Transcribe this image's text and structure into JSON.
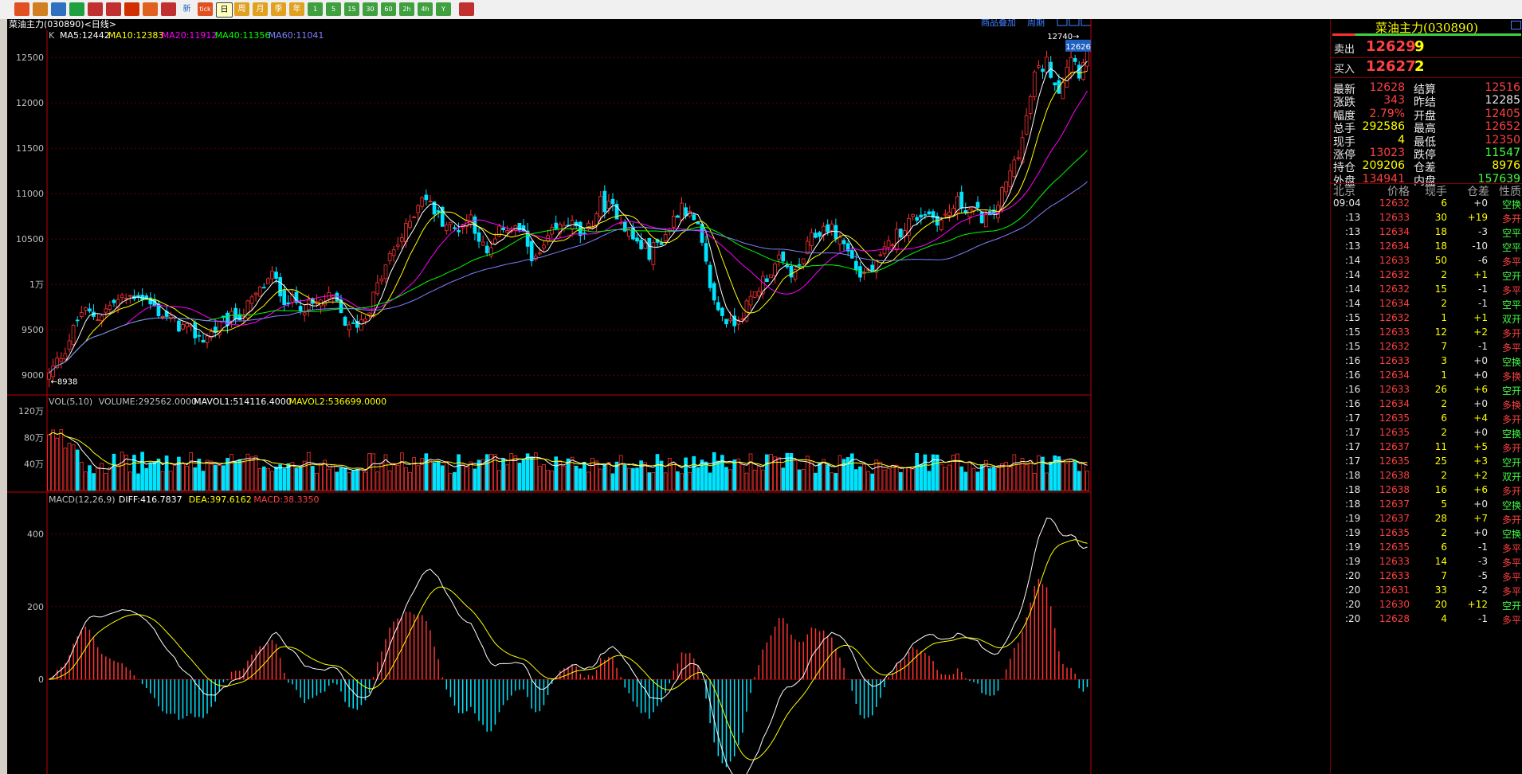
{
  "toolbar": {
    "icons": [
      "home-icon",
      "folder-icon",
      "chart-icon",
      "refresh-icon",
      "zoom-in-icon",
      "zoom-out-icon",
      "draw-icon",
      "tool-icon",
      "signal-icon"
    ],
    "labels": [
      "新",
      "tick",
      "日",
      "周",
      "月",
      "季",
      "年",
      "1",
      "5",
      "15",
      "30",
      "60",
      "2h",
      "4h",
      "Y"
    ]
  },
  "header": {
    "title": "菜油主力(030890)<日线>",
    "links": [
      "商品叠加",
      "周期"
    ]
  },
  "price_pane": {
    "indicator_label": "K",
    "ma": [
      {
        "label": "MA5:12442",
        "color": "#ffffff"
      },
      {
        "label": "MA10:12383",
        "color": "#ffff00"
      },
      {
        "label": "MA20:11912",
        "color": "#ff00ff"
      },
      {
        "label": "MA40:11356",
        "color": "#00ff00"
      },
      {
        "label": "MA60:11041",
        "color": "#8080ff"
      }
    ],
    "yticks": [
      "12500",
      "12000",
      "11500",
      "11000",
      "10500",
      "1万",
      "9500",
      "9000"
    ],
    "high_label": "12740",
    "low_label": "8938",
    "current_tag": "12626"
  },
  "volume_pane": {
    "labels": [
      {
        "text": "VOL(5,10)",
        "color": "#c0c0c0"
      },
      {
        "text": "VOLUME:292562.0000",
        "color": "#c0c0c0"
      },
      {
        "text": "MAVOL1:514116.4000",
        "color": "#ffffff"
      },
      {
        "text": "MAVOL2:536699.0000",
        "color": "#ffff00"
      }
    ],
    "yticks": [
      "120万",
      "80万",
      "40万"
    ]
  },
  "macd_pane": {
    "labels": [
      {
        "text": "MACD(12,26,9)",
        "color": "#c0c0c0"
      },
      {
        "text": "DIFF:416.7837",
        "color": "#ffffff"
      },
      {
        "text": "DEA:397.6162",
        "color": "#ffff00"
      },
      {
        "text": "MACD:38.3350",
        "color": "#ff4040"
      }
    ],
    "yticks": [
      "400",
      "200",
      "0"
    ]
  },
  "chart_data": {
    "type": "candlestick",
    "symbol": "菜油主力(030890)",
    "period": "日线",
    "price_range": [
      8800,
      12800
    ],
    "volume_range": [
      0,
      1250000
    ],
    "macd_range": [
      -260,
      480
    ],
    "anchors": [
      {
        "i": 0,
        "p": 9000
      },
      {
        "i": 4,
        "p": 9300
      },
      {
        "i": 8,
        "p": 9700
      },
      {
        "i": 12,
        "p": 9650
      },
      {
        "i": 16,
        "p": 9800
      },
      {
        "i": 22,
        "p": 9900
      },
      {
        "i": 27,
        "p": 9700
      },
      {
        "i": 32,
        "p": 9550
      },
      {
        "i": 38,
        "p": 9400
      },
      {
        "i": 44,
        "p": 9600
      },
      {
        "i": 48,
        "p": 9700
      },
      {
        "i": 55,
        "p": 10100
      },
      {
        "i": 58,
        "p": 9850
      },
      {
        "i": 64,
        "p": 9750
      },
      {
        "i": 70,
        "p": 9850
      },
      {
        "i": 74,
        "p": 9500
      },
      {
        "i": 78,
        "p": 9650
      },
      {
        "i": 84,
        "p": 10300
      },
      {
        "i": 88,
        "p": 10600
      },
      {
        "i": 92,
        "p": 11000
      },
      {
        "i": 96,
        "p": 10750
      },
      {
        "i": 100,
        "p": 10600
      },
      {
        "i": 104,
        "p": 10750
      },
      {
        "i": 108,
        "p": 10300
      },
      {
        "i": 112,
        "p": 10650
      },
      {
        "i": 116,
        "p": 10600
      },
      {
        "i": 120,
        "p": 10250
      },
      {
        "i": 124,
        "p": 10550
      },
      {
        "i": 128,
        "p": 10700
      },
      {
        "i": 132,
        "p": 10500
      },
      {
        "i": 136,
        "p": 10900
      },
      {
        "i": 140,
        "p": 10800
      },
      {
        "i": 144,
        "p": 10500
      },
      {
        "i": 148,
        "p": 10350
      },
      {
        "i": 152,
        "p": 10550
      },
      {
        "i": 156,
        "p": 10900
      },
      {
        "i": 160,
        "p": 10600
      },
      {
        "i": 164,
        "p": 9800
      },
      {
        "i": 168,
        "p": 9550
      },
      {
        "i": 172,
        "p": 9750
      },
      {
        "i": 176,
        "p": 10050
      },
      {
        "i": 180,
        "p": 10250
      },
      {
        "i": 184,
        "p": 10100
      },
      {
        "i": 188,
        "p": 10500
      },
      {
        "i": 192,
        "p": 10650
      },
      {
        "i": 196,
        "p": 10450
      },
      {
        "i": 200,
        "p": 10100
      },
      {
        "i": 204,
        "p": 10200
      },
      {
        "i": 208,
        "p": 10500
      },
      {
        "i": 212,
        "p": 10700
      },
      {
        "i": 216,
        "p": 10800
      },
      {
        "i": 220,
        "p": 10700
      },
      {
        "i": 224,
        "p": 10900
      },
      {
        "i": 228,
        "p": 10800
      },
      {
        "i": 232,
        "p": 10700
      },
      {
        "i": 236,
        "p": 11100
      },
      {
        "i": 240,
        "p": 11600
      },
      {
        "i": 243,
        "p": 12300
      },
      {
        "i": 246,
        "p": 12450
      },
      {
        "i": 249,
        "p": 12150
      },
      {
        "i": 252,
        "p": 12550
      },
      {
        "i": 254,
        "p": 12350
      },
      {
        "i": 256,
        "p": 12628
      }
    ],
    "count": 257,
    "last": {
      "close": 12628,
      "high": 12652,
      "low": 12350,
      "open": 12405
    },
    "ma_last": {
      "MA5": 12442,
      "MA10": 12383,
      "MA20": 11912,
      "MA40": 11356,
      "MA60": 11041
    },
    "volume_last": 292562,
    "macd_last": {
      "DIFF": 416.7837,
      "DEA": 397.6162,
      "MACD": 38.335
    }
  },
  "panel": {
    "title": "菜油主力(030890)",
    "sell_label": "卖出",
    "sell_price": "12629",
    "sell_qty": "9",
    "buy_label": "买入",
    "buy_price": "12627",
    "buy_qty": "2",
    "stats": [
      {
        "l1": "最新",
        "v1": "12628",
        "c1": "r",
        "l2": "结算",
        "v2": "12516",
        "c2": "r"
      },
      {
        "l1": "涨跌",
        "v1": "343",
        "c1": "r",
        "l2": "昨结",
        "v2": "12285",
        "c2": "w"
      },
      {
        "l1": "幅度",
        "v1": "2.79%",
        "c1": "r",
        "l2": "开盘",
        "v2": "12405",
        "c2": "r"
      },
      {
        "l1": "总手",
        "v1": "292586",
        "c1": "y",
        "l2": "最高",
        "v2": "12652",
        "c2": "r"
      },
      {
        "l1": "现手",
        "v1": "4",
        "c1": "y",
        "l2": "最低",
        "v2": "12350",
        "c2": "r"
      },
      {
        "l1": "涨停",
        "v1": "13023",
        "c1": "r",
        "l2": "跌停",
        "v2": "11547",
        "c2": "g"
      },
      {
        "l1": "持仓",
        "v1": "209206",
        "c1": "y",
        "l2": "仓差",
        "v2": "8976",
        "c2": "y"
      },
      {
        "l1": "外盘",
        "v1": "134941",
        "c1": "r",
        "l2": "内盘",
        "v2": "157639",
        "c2": "g"
      }
    ],
    "tick_header": [
      "北京",
      "价格",
      "现手",
      "仓差",
      "性质"
    ],
    "ticks": [
      [
        "09:04",
        "12632",
        "6",
        "+0",
        "空换"
      ],
      [
        ":13",
        "12633",
        "30",
        "+19",
        "多开"
      ],
      [
        ":13",
        "12634",
        "18",
        "-3",
        "空平"
      ],
      [
        ":13",
        "12634",
        "18",
        "-10",
        "空平"
      ],
      [
        ":14",
        "12633",
        "50",
        "-6",
        "多平"
      ],
      [
        ":14",
        "12632",
        "2",
        "+1",
        "空开"
      ],
      [
        ":14",
        "12632",
        "15",
        "-1",
        "多平"
      ],
      [
        ":14",
        "12634",
        "2",
        "-1",
        "空平"
      ],
      [
        ":15",
        "12632",
        "1",
        "+1",
        "双开"
      ],
      [
        ":15",
        "12633",
        "12",
        "+2",
        "多开"
      ],
      [
        ":15",
        "12632",
        "7",
        "-1",
        "多平"
      ],
      [
        ":16",
        "12633",
        "3",
        "+0",
        "空换"
      ],
      [
        ":16",
        "12634",
        "1",
        "+0",
        "多换"
      ],
      [
        ":16",
        "12633",
        "26",
        "+6",
        "空开"
      ],
      [
        ":16",
        "12634",
        "2",
        "+0",
        "多换"
      ],
      [
        ":17",
        "12635",
        "6",
        "+4",
        "多开"
      ],
      [
        ":17",
        "12635",
        "2",
        "+0",
        "空换"
      ],
      [
        ":17",
        "12637",
        "11",
        "+5",
        "多开"
      ],
      [
        ":17",
        "12635",
        "25",
        "+3",
        "空开"
      ],
      [
        ":18",
        "12638",
        "2",
        "+2",
        "双开"
      ],
      [
        ":18",
        "12638",
        "16",
        "+6",
        "多开"
      ],
      [
        ":18",
        "12637",
        "5",
        "+0",
        "空换"
      ],
      [
        ":19",
        "12637",
        "28",
        "+7",
        "多开"
      ],
      [
        ":19",
        "12635",
        "2",
        "+0",
        "空换"
      ],
      [
        ":19",
        "12635",
        "6",
        "-1",
        "多平"
      ],
      [
        ":19",
        "12633",
        "14",
        "-3",
        "多平"
      ],
      [
        ":20",
        "12633",
        "7",
        "-5",
        "多平"
      ],
      [
        ":20",
        "12631",
        "33",
        "-2",
        "多平"
      ],
      [
        ":20",
        "12630",
        "20",
        "+12",
        "空开"
      ],
      [
        ":20",
        "12628",
        "4",
        "-1",
        "多平"
      ]
    ]
  }
}
